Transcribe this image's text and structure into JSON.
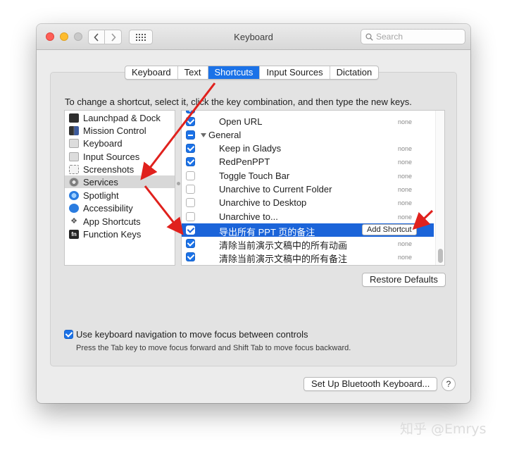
{
  "window": {
    "title": "Keyboard",
    "search_placeholder": "Search"
  },
  "tabs": [
    {
      "label": "Keyboard",
      "active": false
    },
    {
      "label": "Text",
      "active": false
    },
    {
      "label": "Shortcuts",
      "active": true
    },
    {
      "label": "Input Sources",
      "active": false
    },
    {
      "label": "Dictation",
      "active": false
    }
  ],
  "instruction": "To change a shortcut, select it, click the key combination, and then type the new keys.",
  "categories": [
    {
      "label": "Launchpad & Dock",
      "icon": "launchpad-dock-icon"
    },
    {
      "label": "Mission Control",
      "icon": "mission-control-icon"
    },
    {
      "label": "Keyboard",
      "icon": "keyboard-icon"
    },
    {
      "label": "Input Sources",
      "icon": "input-sources-icon"
    },
    {
      "label": "Screenshots",
      "icon": "screenshots-icon"
    },
    {
      "label": "Services",
      "icon": "services-gear-icon",
      "selected": true
    },
    {
      "label": "Spotlight",
      "icon": "spotlight-icon"
    },
    {
      "label": "Accessibility",
      "icon": "accessibility-icon"
    },
    {
      "label": "App Shortcuts",
      "icon": "app-shortcuts-icon"
    },
    {
      "label": "Function Keys",
      "icon": "fn-key-icon",
      "fn_text": "fn"
    }
  ],
  "shortcuts": [
    {
      "name": "Open URL",
      "value": "none",
      "checked": true
    },
    {
      "name": "General",
      "group": true,
      "checked": "mixed"
    },
    {
      "name": "Keep in Gladys",
      "value": "none",
      "checked": true
    },
    {
      "name": "RedPenPPT",
      "value": "none",
      "checked": true
    },
    {
      "name": "Toggle Touch Bar",
      "value": "none",
      "checked": false
    },
    {
      "name": "Unarchive to Current Folder",
      "value": "none",
      "checked": false
    },
    {
      "name": "Unarchive to Desktop",
      "value": "none",
      "checked": false
    },
    {
      "name": "Unarchive to...",
      "value": "none",
      "checked": false
    },
    {
      "name": "导出所有 PPT 页的备注",
      "selected": true,
      "checked": true,
      "add_label": "Add Shortcut"
    },
    {
      "name": "清除当前演示文稿中的所有动画",
      "value": "none",
      "checked": true
    },
    {
      "name": "清除当前演示文稿中的所有备注",
      "value": "none",
      "checked": true
    }
  ],
  "buttons": {
    "restore": "Restore Defaults",
    "bluetooth": "Set Up Bluetooth Keyboard...",
    "help": "?"
  },
  "keyboard_navigation": {
    "label": "Use keyboard navigation to move focus between controls",
    "checked": true,
    "help": "Press the Tab key to move focus forward and Shift Tab to move focus backward."
  },
  "watermark": "知乎 @Emrys",
  "colors": {
    "accent": "#1b72e8",
    "selection": "#1b64d9",
    "annotation_arrow": "#e0211d"
  }
}
